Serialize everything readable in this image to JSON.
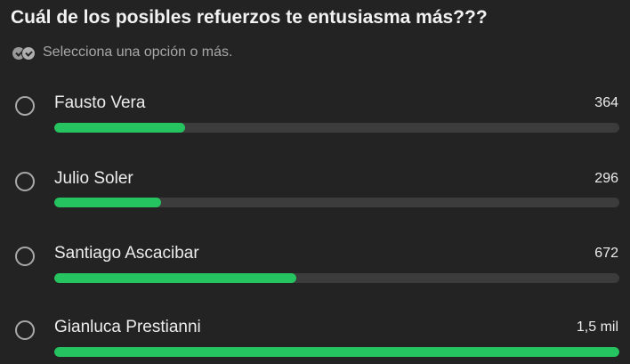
{
  "poll": {
    "question": "Cuál de los posibles refuerzos te entusiasma más???",
    "instruction": "Selecciona una opción o más.",
    "instruction_icon": "double-check-icon",
    "accent_color": "#25c460",
    "options": [
      {
        "label": "Fausto Vera",
        "count": "364",
        "fraction": 0.232
      },
      {
        "label": "Julio Soler",
        "count": "296",
        "fraction": 0.189
      },
      {
        "label": "Santiago Ascacibar",
        "count": "672",
        "fraction": 0.428
      },
      {
        "label": "Gianluca Prestianni",
        "count": "1,5 mil",
        "fraction": 1.0
      }
    ]
  }
}
